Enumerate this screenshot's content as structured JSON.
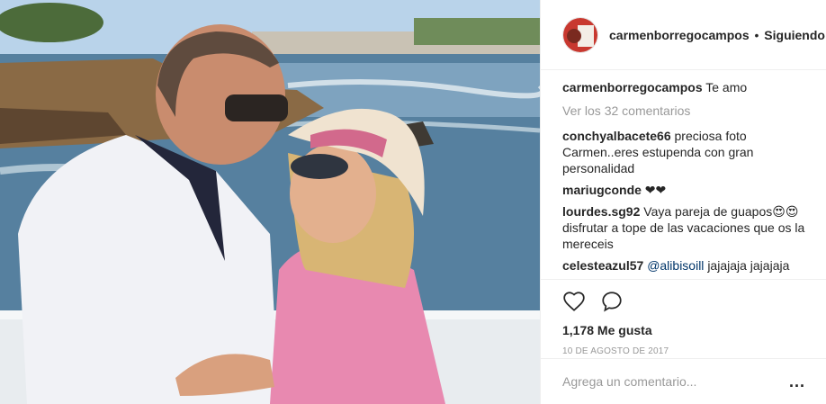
{
  "post": {
    "photo_icon": "photo-couple-seaside"
  },
  "header": {
    "username": "carmenborregocampos",
    "separator": "•",
    "follow_label": "Siguiendo"
  },
  "caption": {
    "username": "carmenborregocampos",
    "text": "Te amo"
  },
  "view_all_comments": "Ver los 32 comentarios",
  "comments": [
    {
      "username": "conchyalbacete66",
      "text": "preciosa foto Carmen..eres estupenda con gran personalidad"
    },
    {
      "username": "mariugconde",
      "text": "❤❤"
    },
    {
      "username": "lourdes.sg92",
      "text": "Vaya pareja de guapos😍😍 disfrutar a tope de las vacaciones que os la mereceis"
    },
    {
      "username": "celesteazul57",
      "mention": "@alibisoill",
      "text": "jajajaja jajajaja"
    }
  ],
  "actions": {
    "like_icon": "heart-icon",
    "comment_icon": "comment-bubble-icon",
    "likes": "1,178 Me gusta",
    "date": "10 de agosto de 2017"
  },
  "add_comment": {
    "placeholder": "Agrega un comentario...",
    "more_label": "..."
  },
  "colors": {
    "border": "#efefef",
    "text": "#262626",
    "muted": "#999999",
    "mention": "#003569"
  }
}
